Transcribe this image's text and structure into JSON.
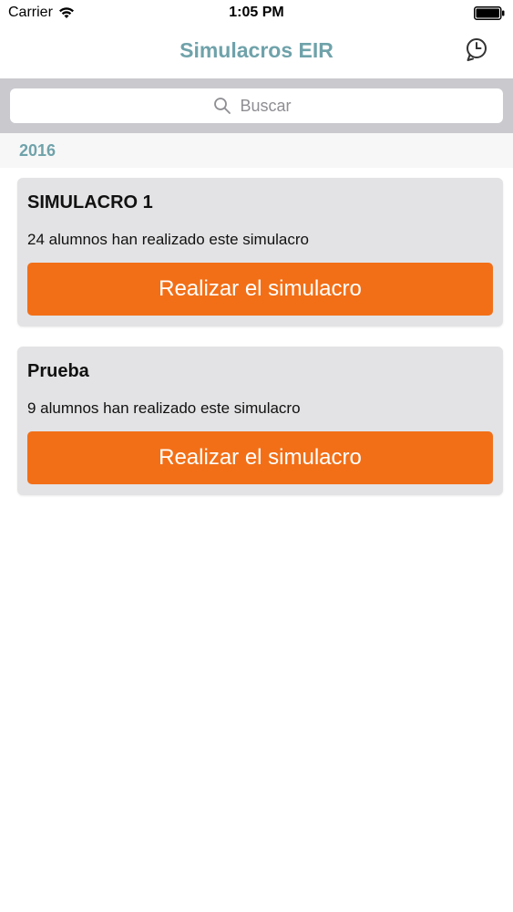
{
  "status_bar": {
    "carrier": "Carrier",
    "time": "1:05 PM",
    "wifi_icon": "wifi-icon",
    "battery_icon": "battery-icon"
  },
  "nav": {
    "title": "Simulacros EIR",
    "history_icon": "history-clock-icon",
    "title_color": "#6fa2aa"
  },
  "search": {
    "placeholder": "Buscar",
    "value": "",
    "icon": "search-icon"
  },
  "section": {
    "title": "2016"
  },
  "simulacros": [
    {
      "title": "SIMULACRO 1",
      "subtitle": "24 alumnos han realizado este simulacro",
      "button_label": "Realizar el simulacro"
    },
    {
      "title": "Prueba",
      "subtitle": "9 alumnos han realizado este simulacro",
      "button_label": "Realizar el simulacro"
    }
  ],
  "colors": {
    "accent": "#f26f17",
    "brand": "#6fa2aa",
    "card_bg": "#e3e3e5",
    "search_bg": "#c9c9ce"
  }
}
